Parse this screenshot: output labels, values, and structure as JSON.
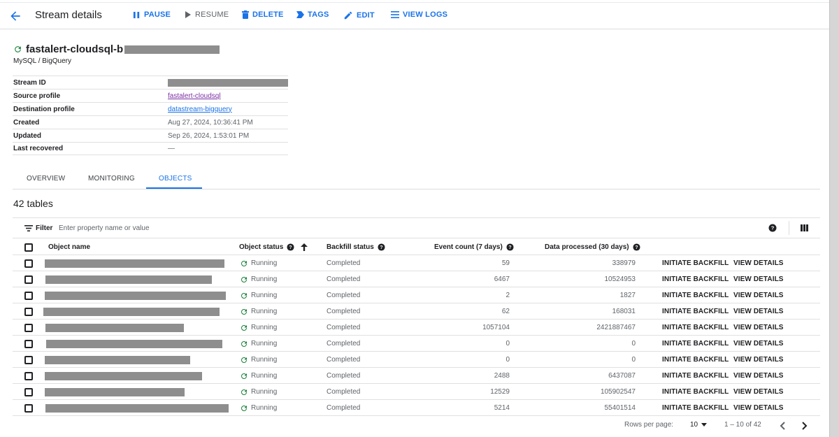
{
  "header": {
    "title": "Stream details",
    "actions": {
      "pause": "PAUSE",
      "resume": "RESUME",
      "delete": "DELETE",
      "tags": "TAGS",
      "edit": "EDIT",
      "view_logs": "VIEW LOGS"
    }
  },
  "stream": {
    "name_visible": "fastalert-cloudsql-b",
    "subtitle": "MySQL / BigQuery"
  },
  "details": [
    {
      "label": "Stream ID",
      "value": ""
    },
    {
      "label": "Source profile",
      "value": "fastalert-cloudsql"
    },
    {
      "label": "Destination profile",
      "value": "datastream-bigquery"
    },
    {
      "label": "Created",
      "value": "Aug 27, 2024, 10:36:41 PM"
    },
    {
      "label": "Updated",
      "value": "Sep 26, 2024, 1:53:01 PM"
    },
    {
      "label": "Last recovered",
      "value": "—"
    }
  ],
  "tabs": {
    "overview": "OVERVIEW",
    "monitoring": "MONITORING",
    "objects": "OBJECTS",
    "active": "objects"
  },
  "objects": {
    "count_title": "42 tables",
    "filter": {
      "label": "Filter",
      "placeholder": "Enter property name or value"
    },
    "columns": {
      "object_name": "Object name",
      "object_status": "Object status",
      "backfill_status": "Backfill status",
      "event_count": "Event count (7 days)",
      "data_processed": "Data processed (30 days)"
    },
    "action_labels": {
      "initiate_backfill": "INITIATE BACKFILL",
      "view_details": "VIEW DETAILS"
    },
    "rows": [
      {
        "status": "Running",
        "backfill": "Completed",
        "events": "59",
        "data": "338979"
      },
      {
        "status": "Running",
        "backfill": "Completed",
        "events": "6467",
        "data": "10524953"
      },
      {
        "status": "Running",
        "backfill": "Completed",
        "events": "2",
        "data": "1827"
      },
      {
        "status": "Running",
        "backfill": "Completed",
        "events": "62",
        "data": "168031"
      },
      {
        "status": "Running",
        "backfill": "Completed",
        "events": "1057104",
        "data": "2421887467"
      },
      {
        "status": "Running",
        "backfill": "Completed",
        "events": "0",
        "data": "0"
      },
      {
        "status": "Running",
        "backfill": "Completed",
        "events": "0",
        "data": "0"
      },
      {
        "status": "Running",
        "backfill": "Completed",
        "events": "2488",
        "data": "6437087"
      },
      {
        "status": "Running",
        "backfill": "Completed",
        "events": "12529",
        "data": "105902547"
      },
      {
        "status": "Running",
        "backfill": "Completed",
        "events": "5214",
        "data": "55401514"
      }
    ],
    "pagination": {
      "rows_per_page_label": "Rows per page:",
      "rows_per_page": "10",
      "range": "1 – 10 of 42"
    }
  },
  "colors": {
    "accent": "#1a73e8",
    "success": "#188038",
    "link_visited": "#7b2fa3"
  },
  "icons": {
    "back": "arrow-back-icon",
    "pause": "pause-icon",
    "resume": "play-icon",
    "delete": "trash-icon",
    "tags": "label-icon",
    "edit": "pencil-icon",
    "view_logs": "list-icon",
    "status": "refresh-running-icon",
    "help": "help-circle-icon",
    "sort": "arrow-up-icon",
    "columns": "column-view-icon",
    "filter": "filter-icon",
    "prev": "chevron-left-icon",
    "next": "chevron-right-icon"
  }
}
